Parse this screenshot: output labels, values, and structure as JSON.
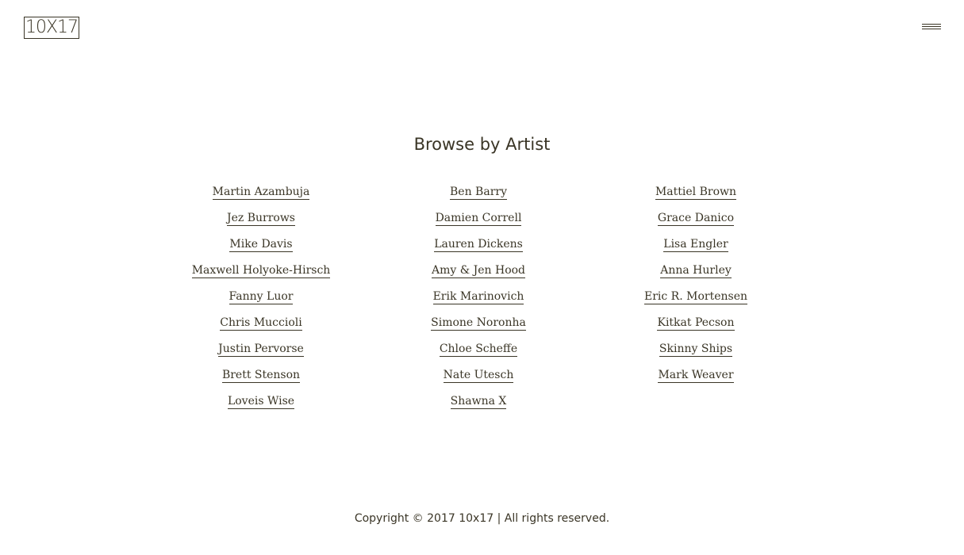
{
  "header": {
    "logo_text": "10X17",
    "menu_icon": "hamburger-menu-icon"
  },
  "main": {
    "title": "Browse by Artist",
    "columns": [
      [
        "Martin Azambuja",
        "Jez Burrows",
        "Mike Davis",
        "Maxwell Holyoke-Hirsch",
        "Fanny Luor",
        "Chris Muccioli",
        "Justin Pervorse",
        "Brett Stenson",
        "Loveis Wise"
      ],
      [
        "Ben Barry",
        "Damien Correll",
        "Lauren Dickens",
        "Amy & Jen Hood",
        "Erik Marinovich",
        "Simone Noronha",
        "Chloe Scheffe",
        "Nate Utesch",
        "Shawna X"
      ],
      [
        "Mattiel Brown",
        "Grace Danico",
        "Lisa Engler",
        "Anna Hurley",
        "Eric R. Mortensen",
        "Kitkat Pecson",
        "Skinny Ships",
        "Mark Weaver"
      ]
    ]
  },
  "footer": {
    "copyright": "Copyright © 2017 10x17 | All rights reserved."
  },
  "colors": {
    "text": "#3a3526",
    "background": "#ffffff"
  }
}
